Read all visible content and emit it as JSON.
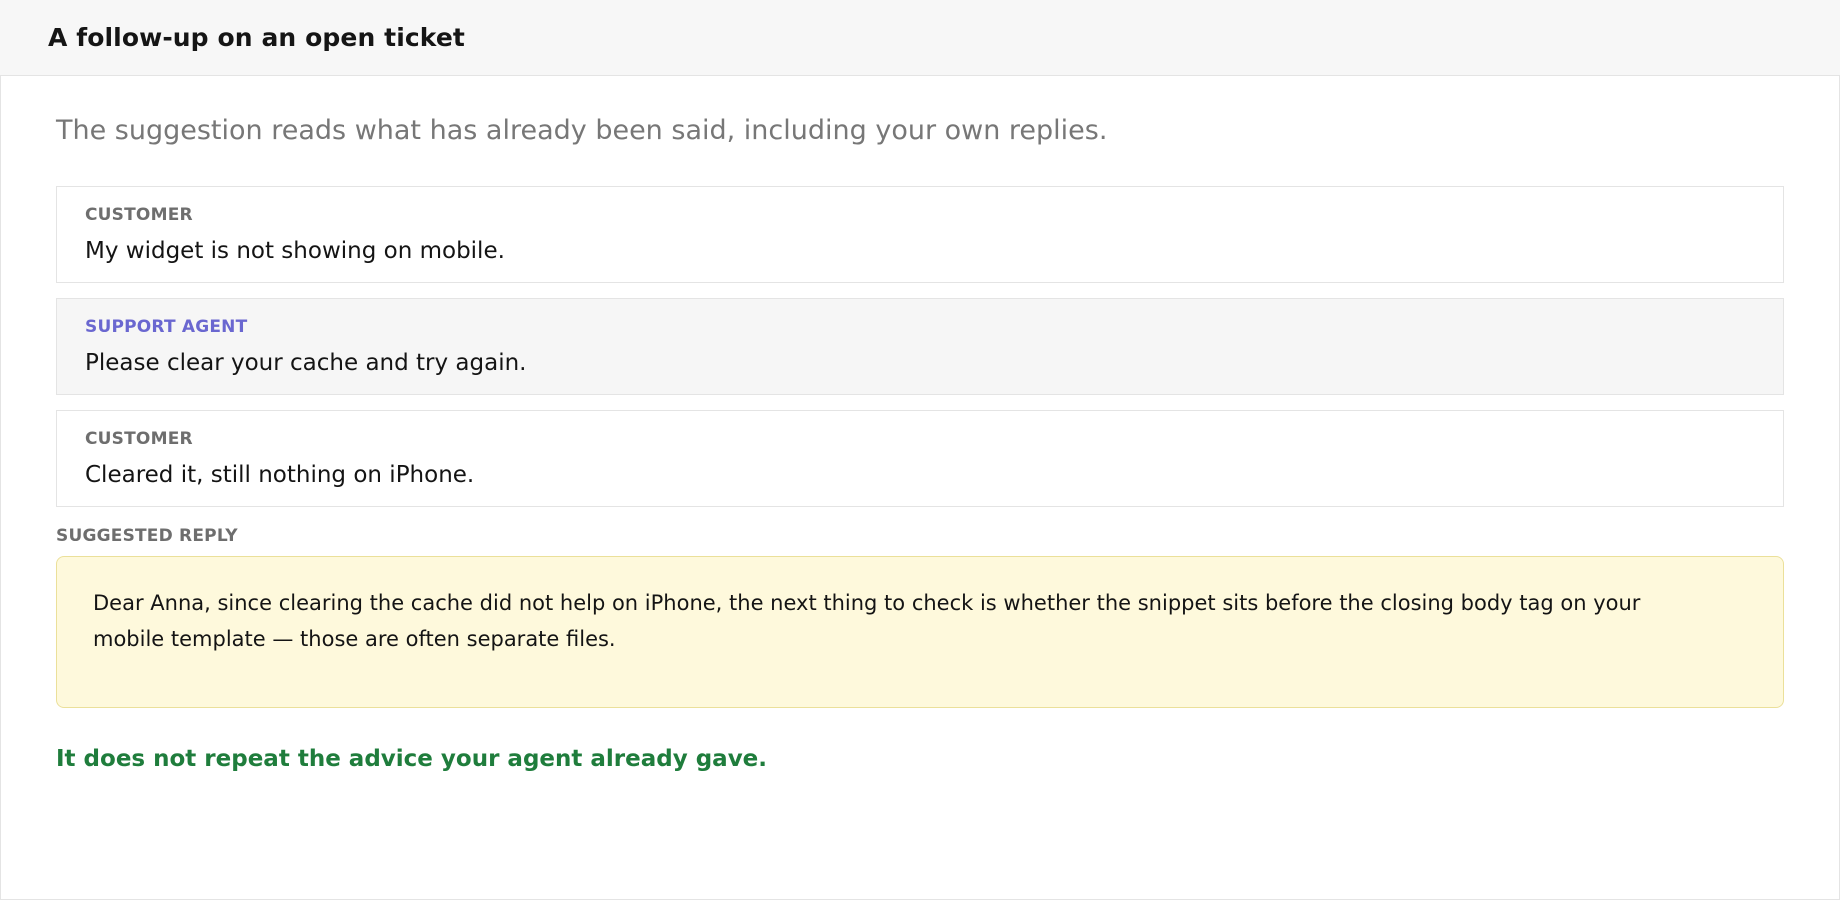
{
  "header": {
    "title": "A follow-up on an open ticket"
  },
  "intro": {
    "text": "The suggestion reads what has already been said, including your own replies."
  },
  "thread": {
    "messages": [
      {
        "role": "CUSTOMER",
        "text": "My widget is not showing on mobile."
      },
      {
        "role": "SUPPORT AGENT",
        "text": "Please clear your cache and try again."
      },
      {
        "role": "CUSTOMER",
        "text": "Cleared it, still nothing on iPhone."
      }
    ]
  },
  "suggestion": {
    "label": "SUGGESTED REPLY",
    "text": "Dear Anna, since clearing the cache did not help on iPhone, the next thing to check is whether the snippet sits before the closing body tag on your mobile template — those are often separate files."
  },
  "note": {
    "text": "It does not repeat the advice your agent already gave."
  },
  "colors": {
    "agent_role": "#6a67d0",
    "suggestion_background": "#fef9dc",
    "suggestion_border": "#ebe09a",
    "note": "#1f7d3c",
    "header_background": "#f7f7f7"
  }
}
